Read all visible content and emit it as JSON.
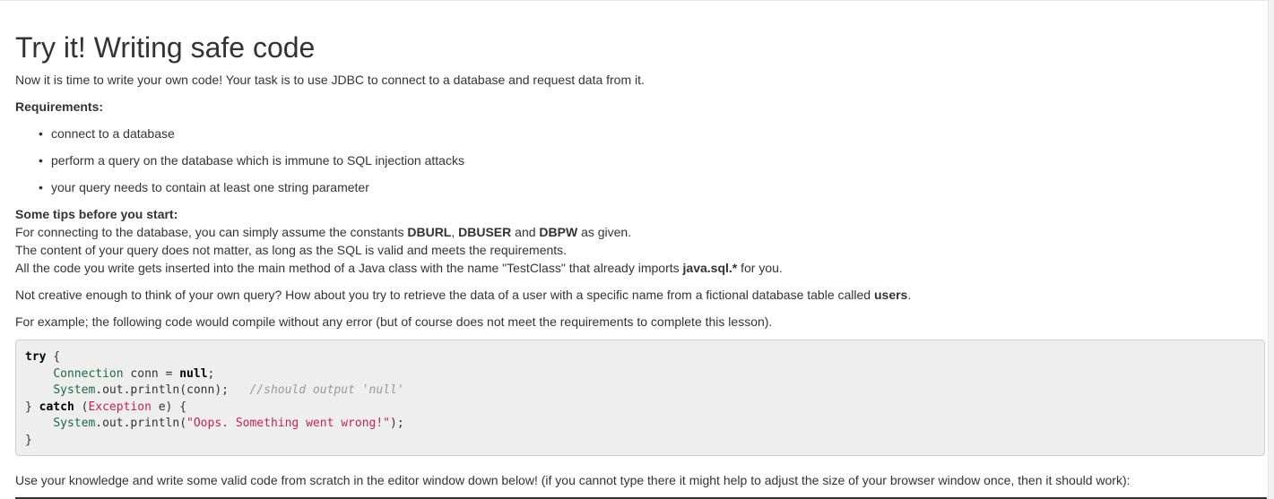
{
  "title": "Try it! Writing safe code",
  "intro": "Now it is time to write your own code! Your task is to use JDBC to connect to a database and request data from it.",
  "requirements_heading": "Requirements:",
  "requirements": [
    "connect to a database",
    "perform a query on the database which is immune to SQL injection attacks",
    "your query needs to contain at least one string parameter"
  ],
  "tips": {
    "heading": "Some tips before you start:",
    "line1_prefix": "For connecting to the database, you can simply assume the constants ",
    "const1": "DBURL",
    "sep1": ", ",
    "const2": "DBUSER",
    "and_text": " and ",
    "const3": "DBPW",
    "line1_suffix": " as given.",
    "line2": "The content of your query does not matter, as long as the SQL is valid and meets the requirements.",
    "line3_prefix": "All the code you write gets inserted into the main method of a Java class with the name \"TestClass\" that already imports ",
    "import_text": "java.sql.*",
    "line3_suffix": " for you."
  },
  "creative": {
    "prefix": "Not creative enough to think of your own query? How about you try to retrieve the data of a user with a specific name from a fictional database table called ",
    "table": "users",
    "suffix": "."
  },
  "example_text": "For example; the following code would compile without any error (but of course does not meet the requirements to complete this lesson).",
  "code": {
    "try": "try",
    "open_brace": " {",
    "connection": "Connection",
    "conn_decl": " conn = ",
    "null": "null",
    "semicolon": ";",
    "system": "System",
    "println_conn": ".out.println(conn);",
    "comment": "//should output 'null'",
    "close_brace": "} ",
    "catch": "catch",
    "paren_open": " (",
    "exception": "Exception",
    "catch_rest": " e) {",
    "println_open": ".out.println(",
    "oops": "\"Oops. Something went wrong!\"",
    "println_close": ");",
    "final_brace": "}"
  },
  "footer_text": "Use your knowledge and write some valid code from scratch in the editor window down below! (if you cannot type there it might help to adjust the size of your browser window once, then it should work):"
}
